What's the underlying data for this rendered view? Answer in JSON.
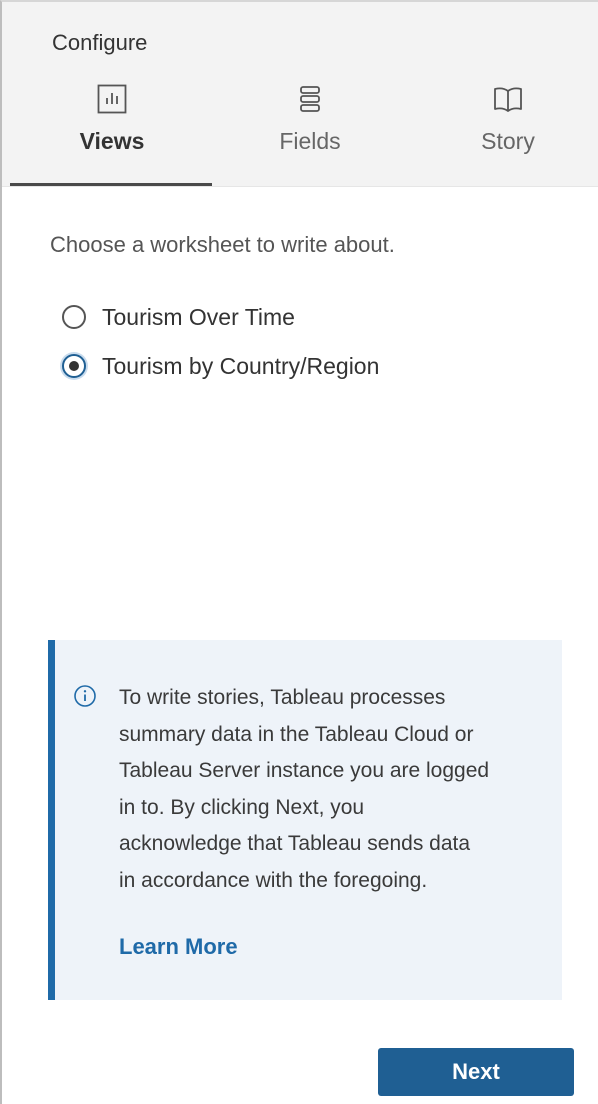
{
  "panel": {
    "title": "Configure"
  },
  "tabs": [
    {
      "label": "Views",
      "icon": "bar-chart-icon",
      "active": true
    },
    {
      "label": "Fields",
      "icon": "fields-list-icon",
      "active": false
    },
    {
      "label": "Story",
      "icon": "book-icon",
      "active": false
    }
  ],
  "main": {
    "prompt": "Choose a worksheet to write about.",
    "options": [
      {
        "label": "Tourism Over Time",
        "selected": false
      },
      {
        "label": "Tourism by Country/Region",
        "selected": true
      }
    ]
  },
  "info": {
    "icon": "info-icon",
    "lines": [
      "To write stories, Tableau processes",
      "summary data in the Tableau Cloud or",
      "Tableau Server instance you are logged",
      "in to. By clicking Next, you",
      "acknowledge that Tableau sends data",
      "in accordance with the foregoing."
    ],
    "link": "Learn More"
  },
  "footer": {
    "next_label": "Next"
  },
  "colors": {
    "accent": "#1f5f93",
    "link": "#1f6aa8",
    "info_bg": "#eef3f9",
    "header_bg": "#f3f3f3"
  }
}
